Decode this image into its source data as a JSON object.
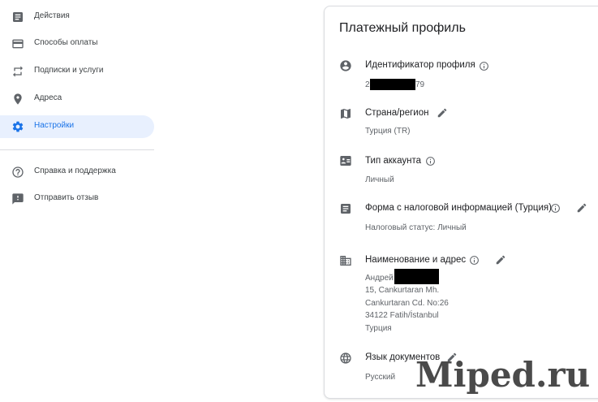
{
  "sidebar": {
    "items": [
      {
        "label": "Действия",
        "icon": "activity-icon"
      },
      {
        "label": "Способы оплаты",
        "icon": "credit-card-icon"
      },
      {
        "label": "Подписки и услуги",
        "icon": "subscriptions-icon"
      },
      {
        "label": "Адреса",
        "icon": "location-pin-icon"
      },
      {
        "label": "Настройки",
        "icon": "gear-icon",
        "active": true
      },
      {
        "label": "Справка и поддержка",
        "icon": "help-icon"
      },
      {
        "label": "Отправить отзыв",
        "icon": "feedback-icon"
      }
    ]
  },
  "profile": {
    "title": "Платежный профиль",
    "profile_id": {
      "label": "Идентификатор профиля",
      "value_start": "2",
      "value_end": "79"
    },
    "country": {
      "label": "Страна/регион",
      "value": "Турция (TR)"
    },
    "account_type": {
      "label": "Тип аккаунта",
      "value": "Личный"
    },
    "tax_form": {
      "label": "Форма с налоговой информацией (Турция)",
      "value": "Налоговый статус: Личный"
    },
    "name_address": {
      "label": "Наименование и адрес",
      "name": "Андрей",
      "lines": [
        "15, Cankurtaran Mh.",
        "Cankurtaran Cd. No:26",
        "34122 Fatih/İstanbul",
        "Турция"
      ]
    },
    "doc_language": {
      "label": "Язык документов",
      "value": "Русский"
    }
  },
  "watermark": "Miped.ru",
  "colors": {
    "accent": "#1a73e8",
    "active_bg": "#e8f0fe",
    "icon": "#5f6368",
    "divider": "#dadce0"
  }
}
